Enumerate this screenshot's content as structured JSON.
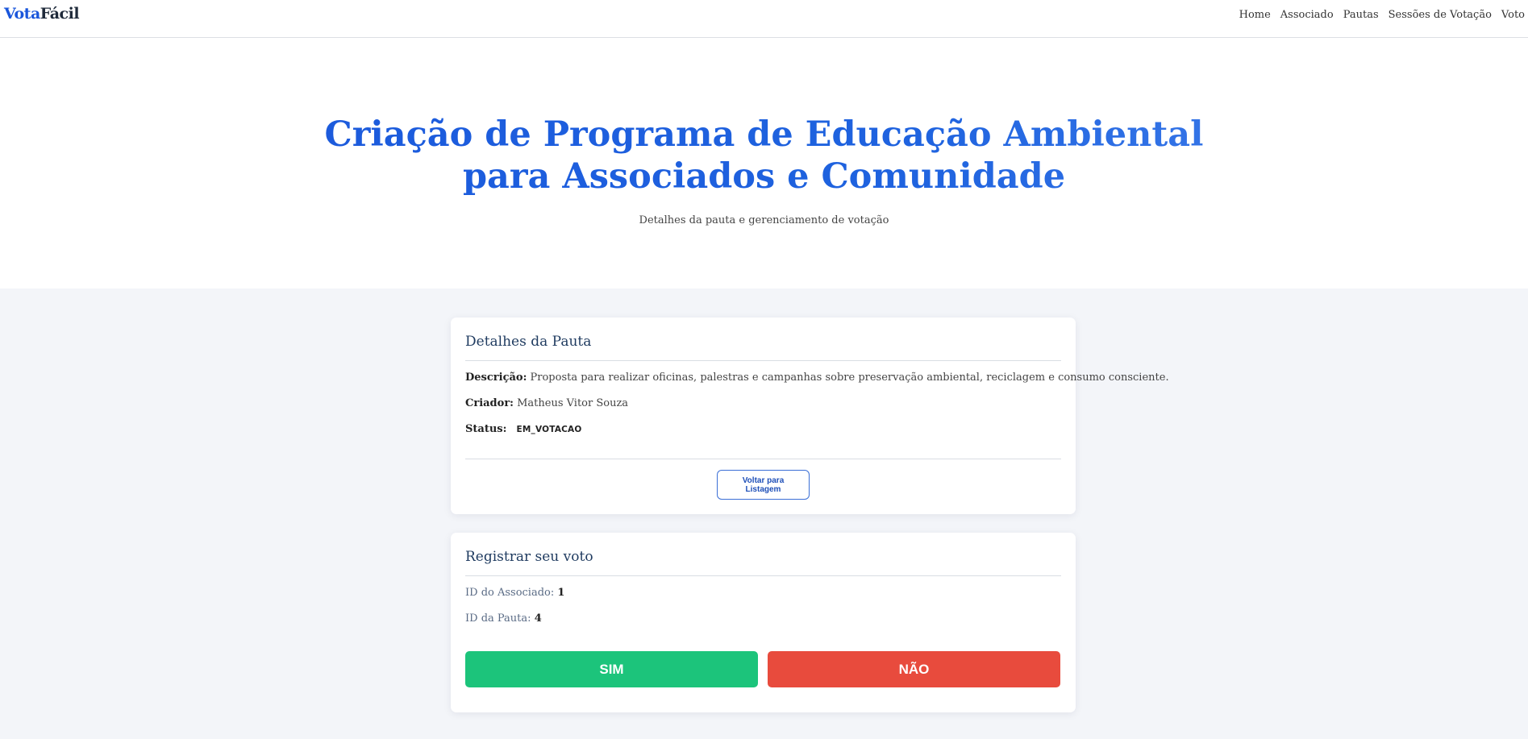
{
  "header": {
    "brand_part1": "Vota",
    "brand_part2": "Fácil",
    "nav": [
      "Home",
      "Associado",
      "Pautas",
      "Sessões de Votação",
      "Voto"
    ]
  },
  "hero": {
    "title_line1": "Criação de Programa de Educação Ambiental",
    "title_line2": "para Associados e Comunidade",
    "subtitle": "Detalhes da pauta e gerenciamento de votação"
  },
  "details": {
    "title": "Detalhes da Pauta",
    "descricao_label": "Descrição:",
    "descricao": "Proposta para realizar oficinas, palestras e campanhas sobre preservação ambiental, reciclagem e consumo consciente.",
    "criador_label": "Criador:",
    "criador": "Matheus Vitor Souza",
    "status_label": "Status:",
    "status": "EM_VOTACAO",
    "back_line1": "Voltar para",
    "back_line2": "Listagem"
  },
  "vote": {
    "title": "Registrar seu voto",
    "associado_label": "ID do Associado:",
    "associado_id": "1",
    "pauta_label": "ID da Pauta:",
    "pauta_id": "4",
    "yes_label": "SIM",
    "no_label": "NÃO"
  },
  "colors": {
    "brand": "#1a56db",
    "yes": "#1cc47b",
    "no": "#e84b3d",
    "background": "#f3f5f9"
  }
}
